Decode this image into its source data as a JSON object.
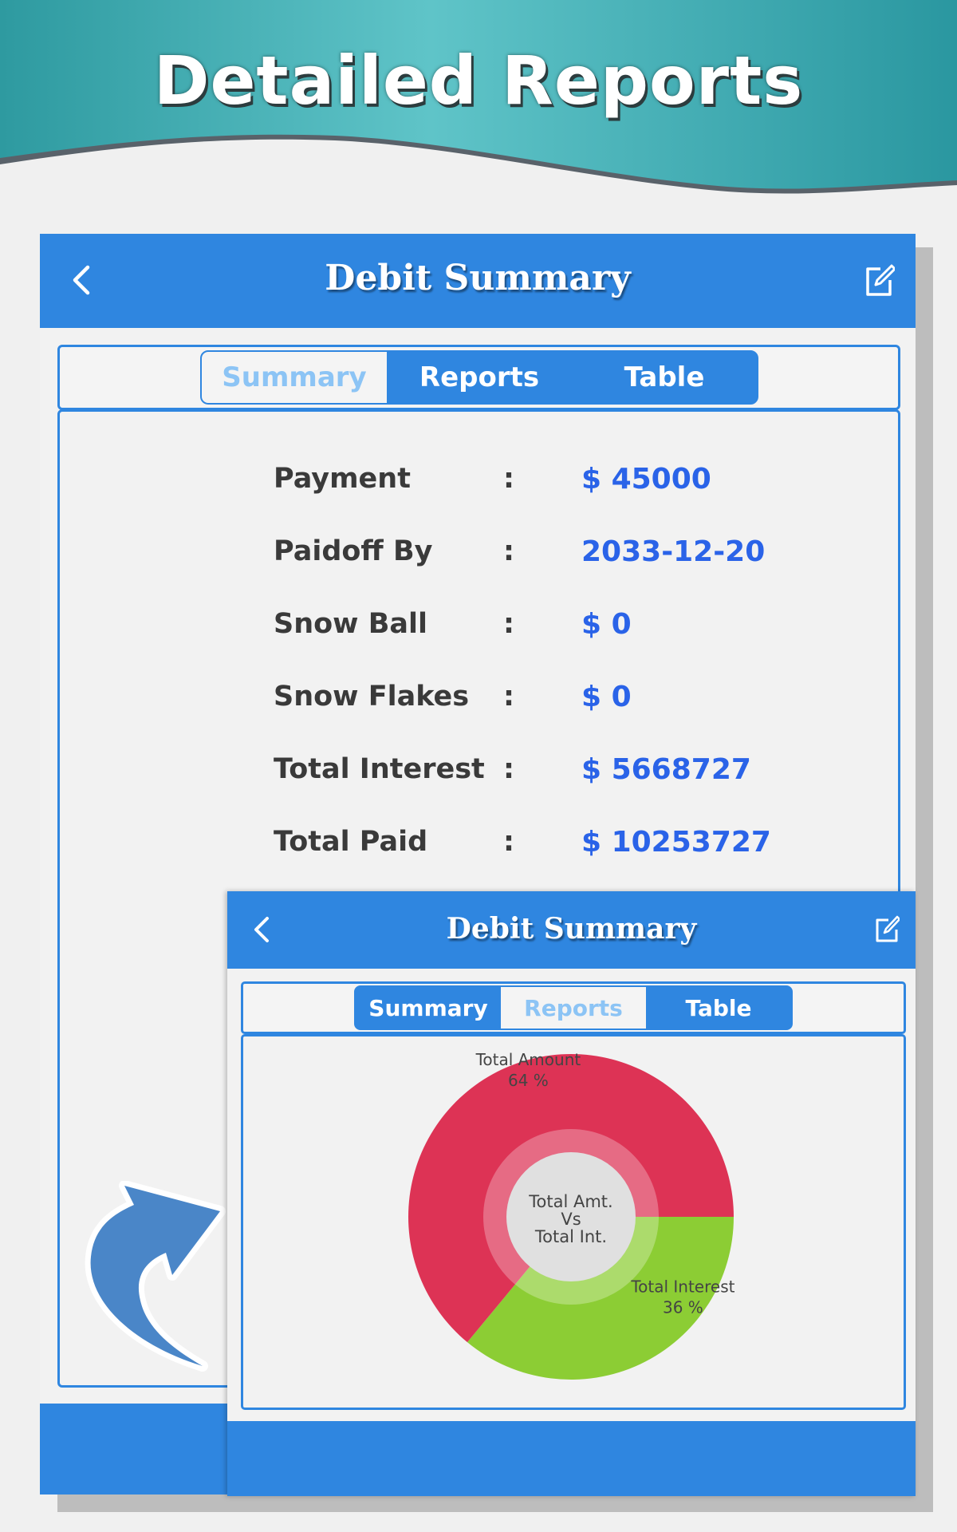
{
  "banner": {
    "title": "Detailed Reports"
  },
  "screen": {
    "title": "Debit Summary",
    "back_icon": "chevron-left-icon",
    "edit_icon": "edit-icon",
    "tabs": [
      {
        "label": "Summary",
        "active": true
      },
      {
        "label": "Reports",
        "active": false
      },
      {
        "label": "Table",
        "active": false
      }
    ],
    "rows": [
      {
        "label": "Payment",
        "sep": ":",
        "value": "$ 45000"
      },
      {
        "label": "Paidoff By",
        "sep": ":",
        "value": "2033-12-20"
      },
      {
        "label": "Snow Ball",
        "sep": ":",
        "value": "$ 0"
      },
      {
        "label": "Snow Flakes",
        "sep": ":",
        "value": "$ 0"
      },
      {
        "label": "Total Interest",
        "sep": ":",
        "value": "$ 5668727"
      },
      {
        "label": "Total Paid",
        "sep": ":",
        "value": "$ 10253727"
      }
    ]
  },
  "screen2": {
    "title": "Debit Summary",
    "tabs": [
      {
        "label": "Summary",
        "active": false
      },
      {
        "label": "Reports",
        "active": true
      },
      {
        "label": "Table",
        "active": false
      }
    ]
  },
  "chart_data": {
    "type": "pie",
    "center_label_lines": [
      "Total Amt.",
      "Vs",
      "Total Int."
    ],
    "series": [
      {
        "name": "Total Amount",
        "value": 64,
        "value_label": "64 %",
        "color": "#dd3355"
      },
      {
        "name": "Total Interest",
        "value": 36,
        "value_label": "36 %",
        "color": "#8ccd34"
      }
    ]
  },
  "colors": {
    "primary": "#2f86e0",
    "value_text": "#2a63e8",
    "inactive_tab_text": "#8cc4f5",
    "banner_teal": "#3fa9b0"
  }
}
